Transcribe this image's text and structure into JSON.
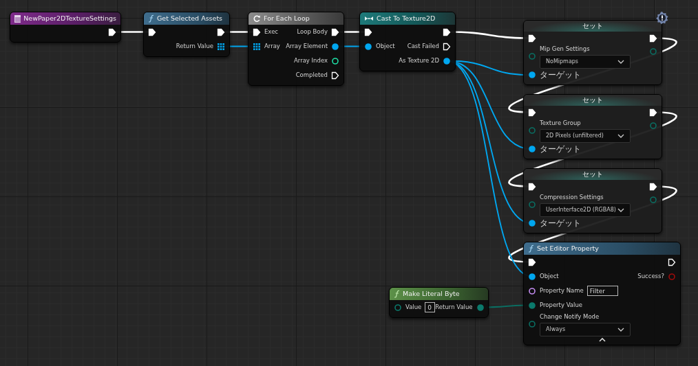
{
  "graph": {
    "nodes": [
      {
        "kind": "event",
        "title": "NewPaper2DTextureSettings",
        "warning": false,
        "rows": [
          {
            "right": {
              "kind": "exec",
              "connected": true
            }
          }
        ]
      },
      {
        "kind": "function",
        "title": "Get Selected Assets",
        "warning": false,
        "rows": [
          {
            "left": {
              "kind": "exec",
              "connected": true
            },
            "right": {
              "kind": "exec",
              "connected": true
            }
          },
          {
            "right": {
              "kind": "array",
              "label": "Return Value",
              "connected": true
            }
          }
        ]
      },
      {
        "kind": "macro",
        "title": "For Each Loop",
        "warning": false,
        "rows": [
          {
            "left": {
              "kind": "exec",
              "label": "Exec",
              "connected": true
            },
            "right": {
              "kind": "exec",
              "label": "Loop Body",
              "connected": true
            }
          },
          {
            "left": {
              "kind": "array",
              "label": "Array",
              "connected": true
            },
            "right": {
              "kind": "object",
              "label": "Array Element",
              "connected": true
            }
          },
          {
            "right": {
              "kind": "int",
              "label": "Array Index",
              "connected": false
            }
          },
          {
            "right": {
              "kind": "exec",
              "label": "Completed",
              "connected": false
            }
          }
        ]
      },
      {
        "kind": "cast",
        "title": "Cast To Texture2D",
        "warning": false,
        "rows": [
          {
            "left": {
              "kind": "exec",
              "connected": true
            },
            "right": {
              "kind": "exec",
              "connected": true
            }
          },
          {
            "left": {
              "kind": "object",
              "label": "Object",
              "connected": true
            },
            "right": {
              "kind": "exec",
              "label": "Cast Failed",
              "connected": false
            }
          },
          {
            "right": {
              "kind": "object",
              "label": "As Texture 2D",
              "connected": true
            }
          }
        ]
      },
      {
        "kind": "set",
        "title": "セット",
        "warning": true,
        "rows": [
          {
            "left": {
              "kind": "exec",
              "connected": true
            },
            "right": {
              "kind": "exec",
              "connected": true
            }
          },
          {
            "left": {
              "kind": "enum",
              "label": "Mip Gen Settings",
              "connected": false,
              "dropdown": "NoMipmaps"
            },
            "right": {
              "kind": "enum",
              "connected": false
            }
          },
          {
            "left": {
              "kind": "object",
              "label": "ターゲット",
              "connected": true
            }
          }
        ]
      },
      {
        "kind": "set",
        "title": "セット",
        "warning": false,
        "rows": [
          {
            "left": {
              "kind": "exec",
              "connected": true
            },
            "right": {
              "kind": "exec",
              "connected": true
            }
          },
          {
            "left": {
              "kind": "enum",
              "label": "Texture Group",
              "connected": false,
              "dropdown": "2D Pixels (unfiltered)"
            },
            "right": {
              "kind": "enum",
              "connected": false
            }
          },
          {
            "left": {
              "kind": "object",
              "label": "ターゲット",
              "connected": true
            }
          }
        ]
      },
      {
        "kind": "set",
        "title": "セット",
        "warning": false,
        "rows": [
          {
            "left": {
              "kind": "exec",
              "connected": true
            },
            "right": {
              "kind": "exec",
              "connected": true
            }
          },
          {
            "left": {
              "kind": "enum",
              "label": "Compression Settings",
              "connected": false,
              "dropdown": "UserInterface2D (RGBA8)"
            },
            "right": {
              "kind": "enum",
              "connected": false
            }
          },
          {
            "left": {
              "kind": "object",
              "label": "ターゲット",
              "connected": true
            }
          }
        ]
      },
      {
        "kind": "function",
        "title": "Set Editor Property",
        "warning": false,
        "advanced_expanded": true,
        "rows": [
          {
            "left": {
              "kind": "exec",
              "connected": true
            },
            "right": {
              "kind": "exec",
              "connected": false
            }
          },
          {
            "left": {
              "kind": "object",
              "label": "Object",
              "connected": true
            },
            "right": {
              "kind": "bool",
              "label": "Success?",
              "connected": false
            }
          },
          {
            "left": {
              "kind": "name",
              "label": "Property Name",
              "connected": false,
              "field": "Filter"
            }
          },
          {
            "left": {
              "kind": "byte",
              "label": "Property Value",
              "connected": true
            }
          },
          {
            "left": {
              "kind": "enum",
              "label": "Change Notify Mode",
              "connected": false,
              "dropdown": "Always"
            }
          }
        ]
      },
      {
        "kind": "pure",
        "title": "Make Literal Byte",
        "warning": false,
        "rows": [
          {
            "left": {
              "kind": "byte",
              "label": "Value",
              "connected": false,
              "field": "0"
            },
            "right": {
              "kind": "byte",
              "label": "Return Value",
              "connected": true
            }
          }
        ]
      }
    ]
  }
}
